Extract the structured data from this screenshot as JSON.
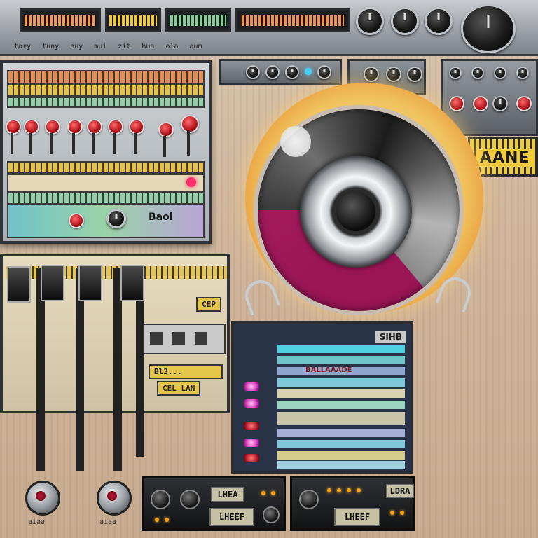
{
  "header": {
    "labels": [
      "tary",
      "tuny",
      "ouy",
      "mui",
      "zit",
      "bua",
      "ola",
      "aum"
    ],
    "display_colors": [
      "#f29a48",
      "#f0c93b",
      "#7fd09b",
      "#f09347"
    ]
  },
  "rack": {
    "label": "Baol",
    "led_color": "#ff2f6a"
  },
  "right_display": {
    "text": "AANE"
  },
  "faders": {
    "tag_top": "CEP",
    "tag_mid": "Bl3...",
    "tag_low": "CEL LAN",
    "knob_labels": [
      "aiaa",
      "aiaa"
    ]
  },
  "mixer": {
    "label": "SIHB",
    "highlight": "BALLAAADE"
  },
  "deck": {
    "left_lcd": "LHEA",
    "left_screen": "LHEEF",
    "right_lcd": "LDRA",
    "right_screen": "LHEEF"
  }
}
